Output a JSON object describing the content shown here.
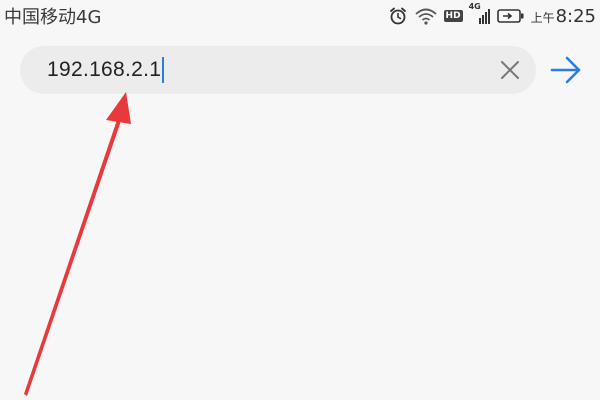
{
  "status_bar": {
    "carrier": "中国移动4G",
    "network_hd": "HD",
    "network_type": "4G",
    "time_ampm": "上午",
    "time": "8:25"
  },
  "address_bar": {
    "url_value": "192.168.2.1"
  },
  "icons": {
    "alarm": "alarm-icon",
    "wifi": "wifi-icon",
    "signal": "signal-icon",
    "battery": "battery-charging-icon",
    "clear": "close-icon",
    "go": "arrow-right-icon",
    "annotation": "red-arrow-annotation"
  },
  "colors": {
    "accent": "#2a7de1",
    "annotation": "#e8393b"
  }
}
